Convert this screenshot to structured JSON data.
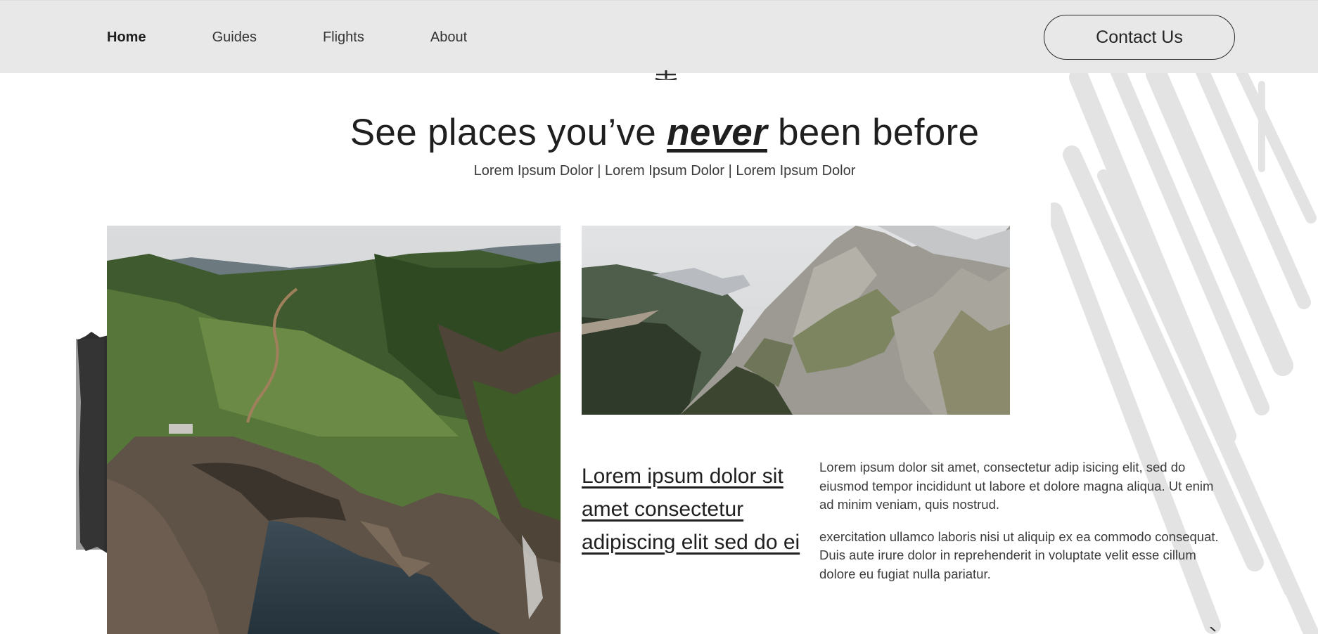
{
  "nav": {
    "items": [
      {
        "label": "Home",
        "active": true
      },
      {
        "label": "Guides",
        "active": false
      },
      {
        "label": "Flights",
        "active": false
      },
      {
        "label": "About",
        "active": false
      }
    ],
    "contact_label": "Contact Us"
  },
  "hero": {
    "title_before": "See places you’ve ",
    "title_emphasis": "never",
    "title_after": " been before",
    "subtitle": "Lorem Ipsum Dolor | Lorem Ipsum Dolor | Lorem Ipsum Dolor"
  },
  "article": {
    "title": "Lorem ipsum dolor sit amet consectetur adipiscing elit sed do ei",
    "paragraphs": [
      "Lorem ipsum dolor sit amet, consectetur adip isicing elit, sed do eiusmod tempor incididunt ut labore et dolore magna aliqua. Ut enim ad minim veniam, quis nostrud.",
      "exercitation ullamco laboris nisi ut aliquip ex ea commodo consequat. Duis aute irure dolor in reprehenderit in voluptate velit esse cillum dolore eu fugiat nulla pariatur."
    ]
  },
  "icons": {
    "anchor": "anchor-icon",
    "next": "chevron-right-icon"
  },
  "colors": {
    "header_bg": "#e9e8e8",
    "text": "#1f1f1f",
    "brush": "#e4e4e4",
    "tape": "#2e2e2e"
  }
}
